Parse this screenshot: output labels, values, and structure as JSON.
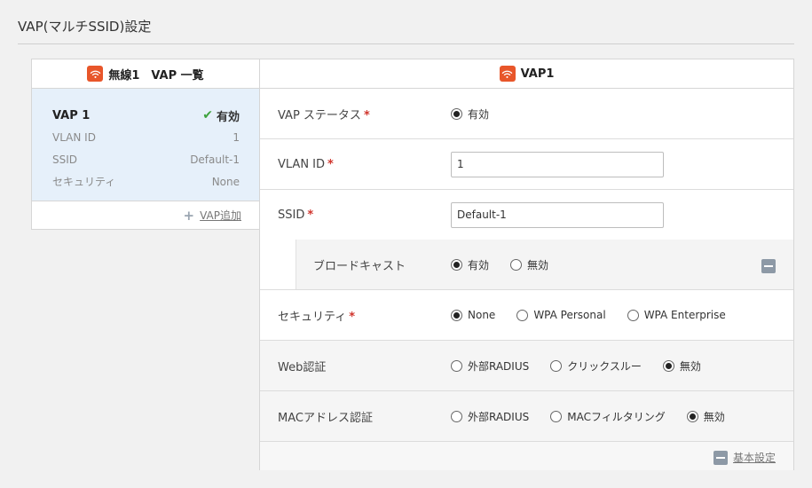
{
  "page": {
    "title": "VAP(マルチSSID)設定"
  },
  "left": {
    "header": "無線1　VAP 一覧",
    "card": {
      "name": "VAP 1",
      "status": "有効",
      "rows": [
        {
          "label": "VLAN ID",
          "value": "1"
        },
        {
          "label": "SSID",
          "value": "Default-1"
        },
        {
          "label": "セキュリティ",
          "value": "None"
        }
      ]
    },
    "add_label": "VAP追加"
  },
  "right": {
    "header": "VAP1",
    "vap_status": {
      "label": "VAP ステータス",
      "req": "*",
      "options": [
        "有効"
      ]
    },
    "vlan": {
      "label": "VLAN ID",
      "req": "*",
      "value": "1"
    },
    "ssid": {
      "label": "SSID",
      "req": "*",
      "value": "Default-1"
    },
    "broadcast": {
      "label": "ブロードキャスト",
      "options": [
        "有効",
        "無効"
      ]
    },
    "security": {
      "label": "セキュリティ",
      "req": "*",
      "options": [
        "None",
        "WPA Personal",
        "WPA Enterprise"
      ]
    },
    "web_auth": {
      "label": "Web認証",
      "options": [
        "外部RADIUS",
        "クリックスルー",
        "無効"
      ]
    },
    "mac_auth": {
      "label": "MACアドレス認証",
      "options": [
        "外部RADIUS",
        "MACフィルタリング",
        "無効"
      ]
    },
    "basic_link": "基本設定"
  },
  "colors": {
    "accent": "#e8562a",
    "check": "#3ea33e",
    "required": "#d0342c",
    "selected_card": "#e6f0fa"
  }
}
